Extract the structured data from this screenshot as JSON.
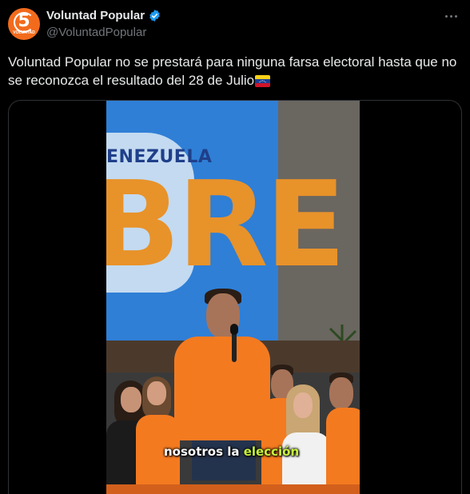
{
  "header": {
    "display_name": "Voluntad Popular",
    "handle": "@VoluntadPopular",
    "avatar_number": "5",
    "avatar_sub": "VOLUNTAD"
  },
  "tweet": {
    "text": "Voluntad Popular no se prestará para ninguna farsa electoral hasta que no se reconozca el resultado del 28 de Julio"
  },
  "video": {
    "screen_text_1": "ENEZUELA",
    "screen_text_2": "BRE",
    "caption_1": "nosotros la ",
    "caption_2": "elección"
  },
  "colors": {
    "brand_orange": "#f26b1d",
    "verified_blue": "#1d9bf0",
    "caption_highlight": "#c7f43b"
  },
  "icons": {
    "verified": "verified-badge-icon",
    "more": "more-options-icon",
    "flag": "venezuela-flag-icon"
  }
}
